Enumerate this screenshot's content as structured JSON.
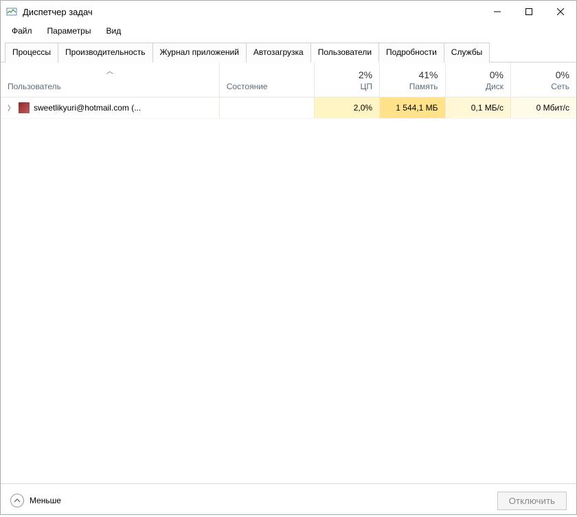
{
  "window": {
    "title": "Диспетчер задач"
  },
  "menu": {
    "file": "Файл",
    "options": "Параметры",
    "view": "Вид"
  },
  "tabs": {
    "processes": "Процессы",
    "performance": "Производительность",
    "app_history": "Журнал приложений",
    "startup": "Автозагрузка",
    "users": "Пользователи",
    "details": "Подробности",
    "services": "Службы",
    "active": "users"
  },
  "columns": {
    "user_label": "Пользователь",
    "status_label": "Состояние",
    "cpu": {
      "pct": "2%",
      "label": "ЦП"
    },
    "memory": {
      "pct": "41%",
      "label": "Память"
    },
    "disk": {
      "pct": "0%",
      "label": "Диск"
    },
    "network": {
      "pct": "0%",
      "label": "Сеть"
    }
  },
  "rows": [
    {
      "user": "sweetlikyuri@hotmail.com (...",
      "status": "",
      "cpu": "2,0%",
      "memory": "1 544,1 МБ",
      "disk": "0,1 МБ/с",
      "network": "0 Мбит/с"
    }
  ],
  "footer": {
    "fewer": "Меньше",
    "disconnect": "Отключить"
  }
}
